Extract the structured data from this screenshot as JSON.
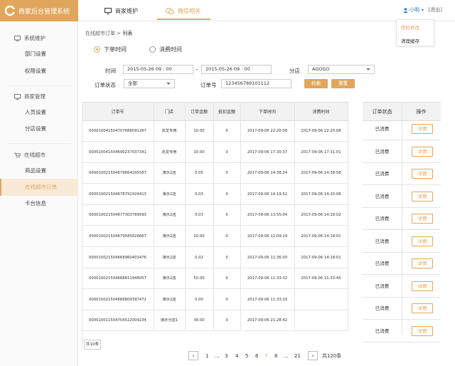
{
  "app": {
    "title": "商家后台管理系统"
  },
  "topnav": {
    "tabs": [
      {
        "label": "商家维护"
      },
      {
        "label": "微信相关"
      }
    ],
    "user": "小明",
    "logout": "[退出]"
  },
  "user_menu": {
    "items": [
      "密码修改",
      "清理缓存"
    ]
  },
  "sidebar": {
    "groups": [
      {
        "title": "系统维护",
        "items": [
          "部门设置",
          "权限设置"
        ]
      },
      {
        "title": "商家管理",
        "items": [
          "人员设置",
          "分店设置"
        ]
      },
      {
        "title": "在线超市",
        "items": [
          "商品设置",
          "在线超市订单",
          "卡台信息"
        ]
      }
    ]
  },
  "breadcrumb": {
    "parent": "在线超市订单",
    "sep": " > ",
    "current": "列表"
  },
  "filters": {
    "time_type_options": [
      "下单时间",
      "消费时间"
    ],
    "selected_time_type": "下单时间",
    "time_label": "时间",
    "start_time": "2015-05-26  09 : 00",
    "range_sep": "–",
    "end_time": "2015-05-26  09 : 00",
    "store_label": "分店",
    "store_value": "AGOGO",
    "status_label": "订单状态",
    "status_value": "全部",
    "order_no_label": "订单号",
    "order_no_value": "123456789101112",
    "search_label": "检索",
    "reset_label": "重置"
  },
  "table": {
    "columns": [
      "订单号",
      "门店",
      "订单金额",
      "抵扣金额",
      "下单时间",
      "消费时间"
    ],
    "rows": [
      [
        "0000100415047076880912​67",
        "兆龙专用",
        "10.00",
        "0",
        "2017-09-06 22:20:08",
        "2017-09-06 22:20:08"
      ],
      [
        "000010041504690237037341",
        "兆龙专用",
        "10.00",
        "0",
        "2017-09-06 17:30:37",
        "2017-09-06 17:31:01"
      ],
      [
        "000010021504679664295587",
        "演示2店",
        "0.05",
        "0",
        "2017-09-06 14:38:24",
        "2017-09-06 14:38:58"
      ],
      [
        "000010021504678791924413",
        "演示2店",
        "0.03",
        "0",
        "2017-09-06 14:19:52",
        "2017-09-06 14:20:06"
      ],
      [
        "000010021504677303789593",
        "演示2店",
        "0.03",
        "0",
        "2017-09-06 13:55:04",
        "2017-09-06 14:18:02"
      ],
      [
        "000010021504679585828667",
        "演示2店",
        "20.00",
        "0",
        "2017-09-06 12:09:19",
        "2017-09-06 14:18:01"
      ],
      [
        "000010021504668960403476",
        "演示2店",
        "0.02",
        "0",
        "2017-09-06 11:36:00",
        "2017-09-06 14:18:01"
      ],
      [
        "000010021504668811948057",
        "演示2店",
        "50.00",
        "0",
        "2017-09-06 11:33:32",
        "2017-09-06 11:33:45"
      ],
      [
        "000010021504668809397472",
        "演示2店",
        "0.00",
        "0",
        "2017-09-06 11:33:29",
        ""
      ],
      [
        "000010011504704522009234",
        "演示分店1",
        "38.00",
        "0",
        "2017-09-06 21:28:42",
        ""
      ]
    ]
  },
  "side_table": {
    "columns": [
      "订单状态",
      "操作"
    ],
    "statuses": [
      "已消费",
      "已消费",
      "已消费",
      "已消费",
      "已消费",
      "已消费",
      "已消费",
      "已消费",
      "已消费",
      "已消费"
    ],
    "detail_label": "详情"
  },
  "footer": {
    "total_tag": "共10条",
    "pages": [
      "1",
      "...",
      "3",
      "4",
      "5",
      "6",
      "7",
      "8",
      "...",
      "21"
    ],
    "current_page": "7",
    "total": "共120条",
    "prev": "‹",
    "next": "›"
  },
  "colors": {
    "accent": "#e0a75c",
    "link": "#2a79c4"
  }
}
